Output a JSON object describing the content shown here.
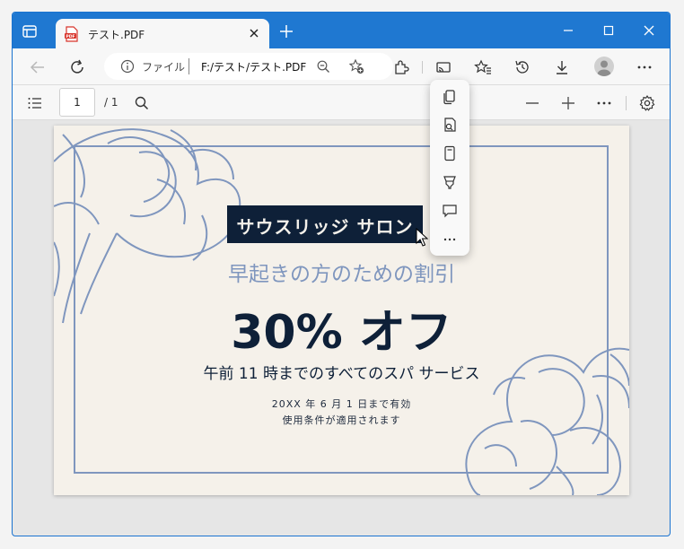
{
  "titlebar": {
    "tab_title": "テスト.PDF",
    "pdf_icon_text": "PDF",
    "accent": "#1f78d1"
  },
  "toolbar": {
    "address_label": "ファイル",
    "url": "F:/テスト/テスト.PDF"
  },
  "pdfbar": {
    "page_number": "1",
    "page_total": "/ 1"
  },
  "document": {
    "banner": "サウスリッジ サロン",
    "subtitle": "早起きの方のための割引",
    "headline": "30% オフ",
    "description": "午前 11 時までのすべてのスパ サービス",
    "fine_print_1": "20XX 年 6 月 1 日まで有効",
    "fine_print_2": "使用条件が適用されます",
    "colors": {
      "navy": "#0e2038",
      "accent": "#7f96be",
      "paper": "#f5f1ea"
    }
  },
  "popup": {
    "items": [
      "copy-icon",
      "search-doc-icon",
      "document-icon",
      "highlight-icon",
      "comment-icon",
      "more-icon"
    ]
  }
}
